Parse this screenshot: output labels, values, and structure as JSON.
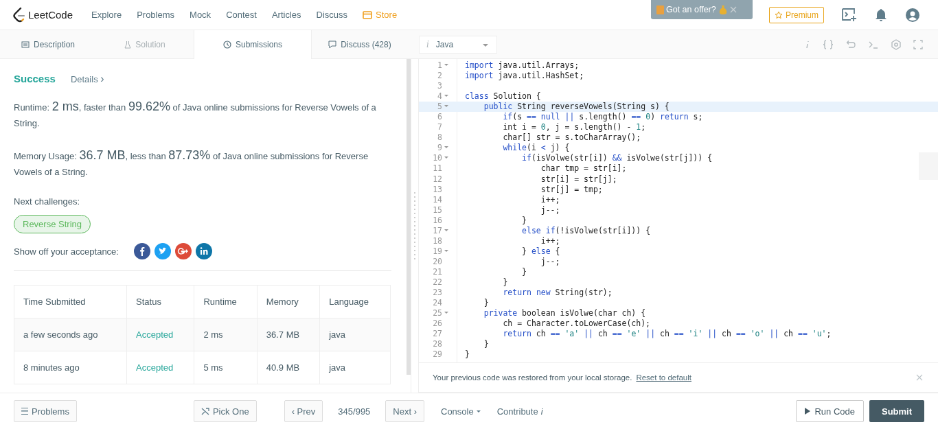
{
  "header": {
    "logo": "LeetCode",
    "nav": [
      {
        "label": "Explore",
        "kind": "plain"
      },
      {
        "label": "Problems",
        "kind": "plain"
      },
      {
        "label": "Mock",
        "kind": "plain"
      },
      {
        "label": "Contest",
        "kind": "plain"
      },
      {
        "label": "Articles",
        "kind": "plain"
      },
      {
        "label": "Discuss",
        "kind": "plain"
      },
      {
        "label": "Store",
        "kind": "store"
      }
    ],
    "offer": "Got an offer?",
    "premium": "Premium"
  },
  "tabs": [
    {
      "label": "Description",
      "selected": false,
      "disabled": false
    },
    {
      "label": "Solution",
      "selected": false,
      "disabled": true
    },
    {
      "label": "Submissions",
      "selected": true,
      "disabled": false
    },
    {
      "label": "Discuss (428)",
      "selected": false,
      "disabled": false
    }
  ],
  "language_select": {
    "info": "i",
    "value": "Java"
  },
  "result": {
    "status": "Success",
    "details": "Details",
    "details_chevron": "›",
    "runtime": {
      "label": "Runtime:",
      "value": "2 ms",
      "mid": ", faster than",
      "percent": "99.62%",
      "rest": "of Java online submissions for Reverse Vowels of a String."
    },
    "memory": {
      "label": "Memory Usage:",
      "value": "36.7 MB",
      "mid": ", less than",
      "percent": "87.73%",
      "rest": "of Java online submissions for Reverse Vowels of a String."
    },
    "next_label": "Next challenges:",
    "next": [
      "Reverse String"
    ],
    "share_label": "Show off your acceptance:"
  },
  "table": {
    "columns": [
      "Time Submitted",
      "Status",
      "Runtime",
      "Memory",
      "Language"
    ],
    "rows": [
      [
        "a few seconds ago",
        "Accepted",
        "2 ms",
        "36.7 MB",
        "java"
      ],
      [
        "8 minutes ago",
        "Accepted",
        "5 ms",
        "40.9 MB",
        "java"
      ]
    ]
  },
  "code": [
    {
      "n": "1",
      "text": "import java.util.Arrays;",
      "fold": true,
      "selected": false
    },
    {
      "n": "2",
      "text": "import java.util.HashSet;",
      "fold": false,
      "selected": false
    },
    {
      "n": "3",
      "fold": false,
      "selected": false
    },
    {
      "n": "4",
      "text": "class Solution {",
      "fold": true,
      "selected": false
    },
    {
      "n": "5",
      "text": "    public String reverseVowels(String s) {",
      "fold": true,
      "selected": true
    },
    {
      "n": "6",
      "text": "        if(s == null || s.length() == 0) return s;",
      "fold": false,
      "selected": false
    },
    {
      "n": "7",
      "text": "        int i = 0, j = s.length() - 1;",
      "fold": false,
      "selected": false
    },
    {
      "n": "8",
      "text": "        char[] str = s.toCharArray();",
      "fold": false,
      "selected": false
    },
    {
      "n": "9",
      "text": "        while(i < j) {",
      "fold": true,
      "selected": false
    },
    {
      "n": "10",
      "text": "            if(isVolwe(str[i]) && isVolwe(str[j])) {",
      "fold": true,
      "selected": false
    },
    {
      "n": "11",
      "text": "                char tmp = str[i];",
      "fold": false,
      "selected": false
    },
    {
      "n": "12",
      "text": "                str[i] = str[j];",
      "fold": false,
      "selected": false
    },
    {
      "n": "13",
      "text": "                str[j] = tmp;",
      "fold": false,
      "selected": false
    },
    {
      "n": "14",
      "text": "                i++;",
      "fold": false,
      "selected": false
    },
    {
      "n": "15",
      "text": "                j--;",
      "fold": false,
      "selected": false
    },
    {
      "n": "16",
      "text": "            }",
      "fold": false,
      "selected": false
    },
    {
      "n": "17",
      "text": "            else if(!isVolwe(str[i])) {",
      "fold": true,
      "selected": false
    },
    {
      "n": "18",
      "text": "                i++;",
      "fold": false,
      "selected": false
    },
    {
      "n": "19",
      "text": "            } else {",
      "fold": true,
      "selected": false
    },
    {
      "n": "20",
      "text": "                j--;",
      "fold": false,
      "selected": false
    },
    {
      "n": "21",
      "text": "            }",
      "fold": false,
      "selected": false
    },
    {
      "n": "22",
      "text": "        }",
      "fold": false,
      "selected": false
    },
    {
      "n": "23",
      "text": "        return new String(str);",
      "fold": false,
      "selected": false
    },
    {
      "n": "24",
      "text": "    }",
      "fold": false,
      "selected": false
    },
    {
      "n": "25",
      "text": "    private boolean isVolwe(char ch) {",
      "fold": true,
      "selected": false
    },
    {
      "n": "26",
      "text": "        ch = Character.toLowerCase(ch);",
      "fold": false,
      "selected": false
    },
    {
      "n": "27",
      "text": "        return ch == 'a' || ch == 'e' || ch == 'i' || ch == 'o' || ch == 'u';",
      "fold": false,
      "selected": false
    },
    {
      "n": "28",
      "text": "    }",
      "fold": false,
      "selected": false
    },
    {
      "n": "29",
      "text": "}",
      "fold": false,
      "selected": false
    }
  ],
  "notice": {
    "text": "Your previous code was restored from your local storage.",
    "link": "Reset to default"
  },
  "footer_left": {
    "problems": "Problems",
    "pick": "Pick One",
    "prev_arrow": "‹",
    "prev": "Prev",
    "count": "345/995",
    "next": "Next",
    "next_arrow": "›"
  },
  "footer_right": {
    "console": "Console",
    "contribute": "Contribute",
    "info": "i",
    "run": "Run Code",
    "submit": "Submit"
  }
}
